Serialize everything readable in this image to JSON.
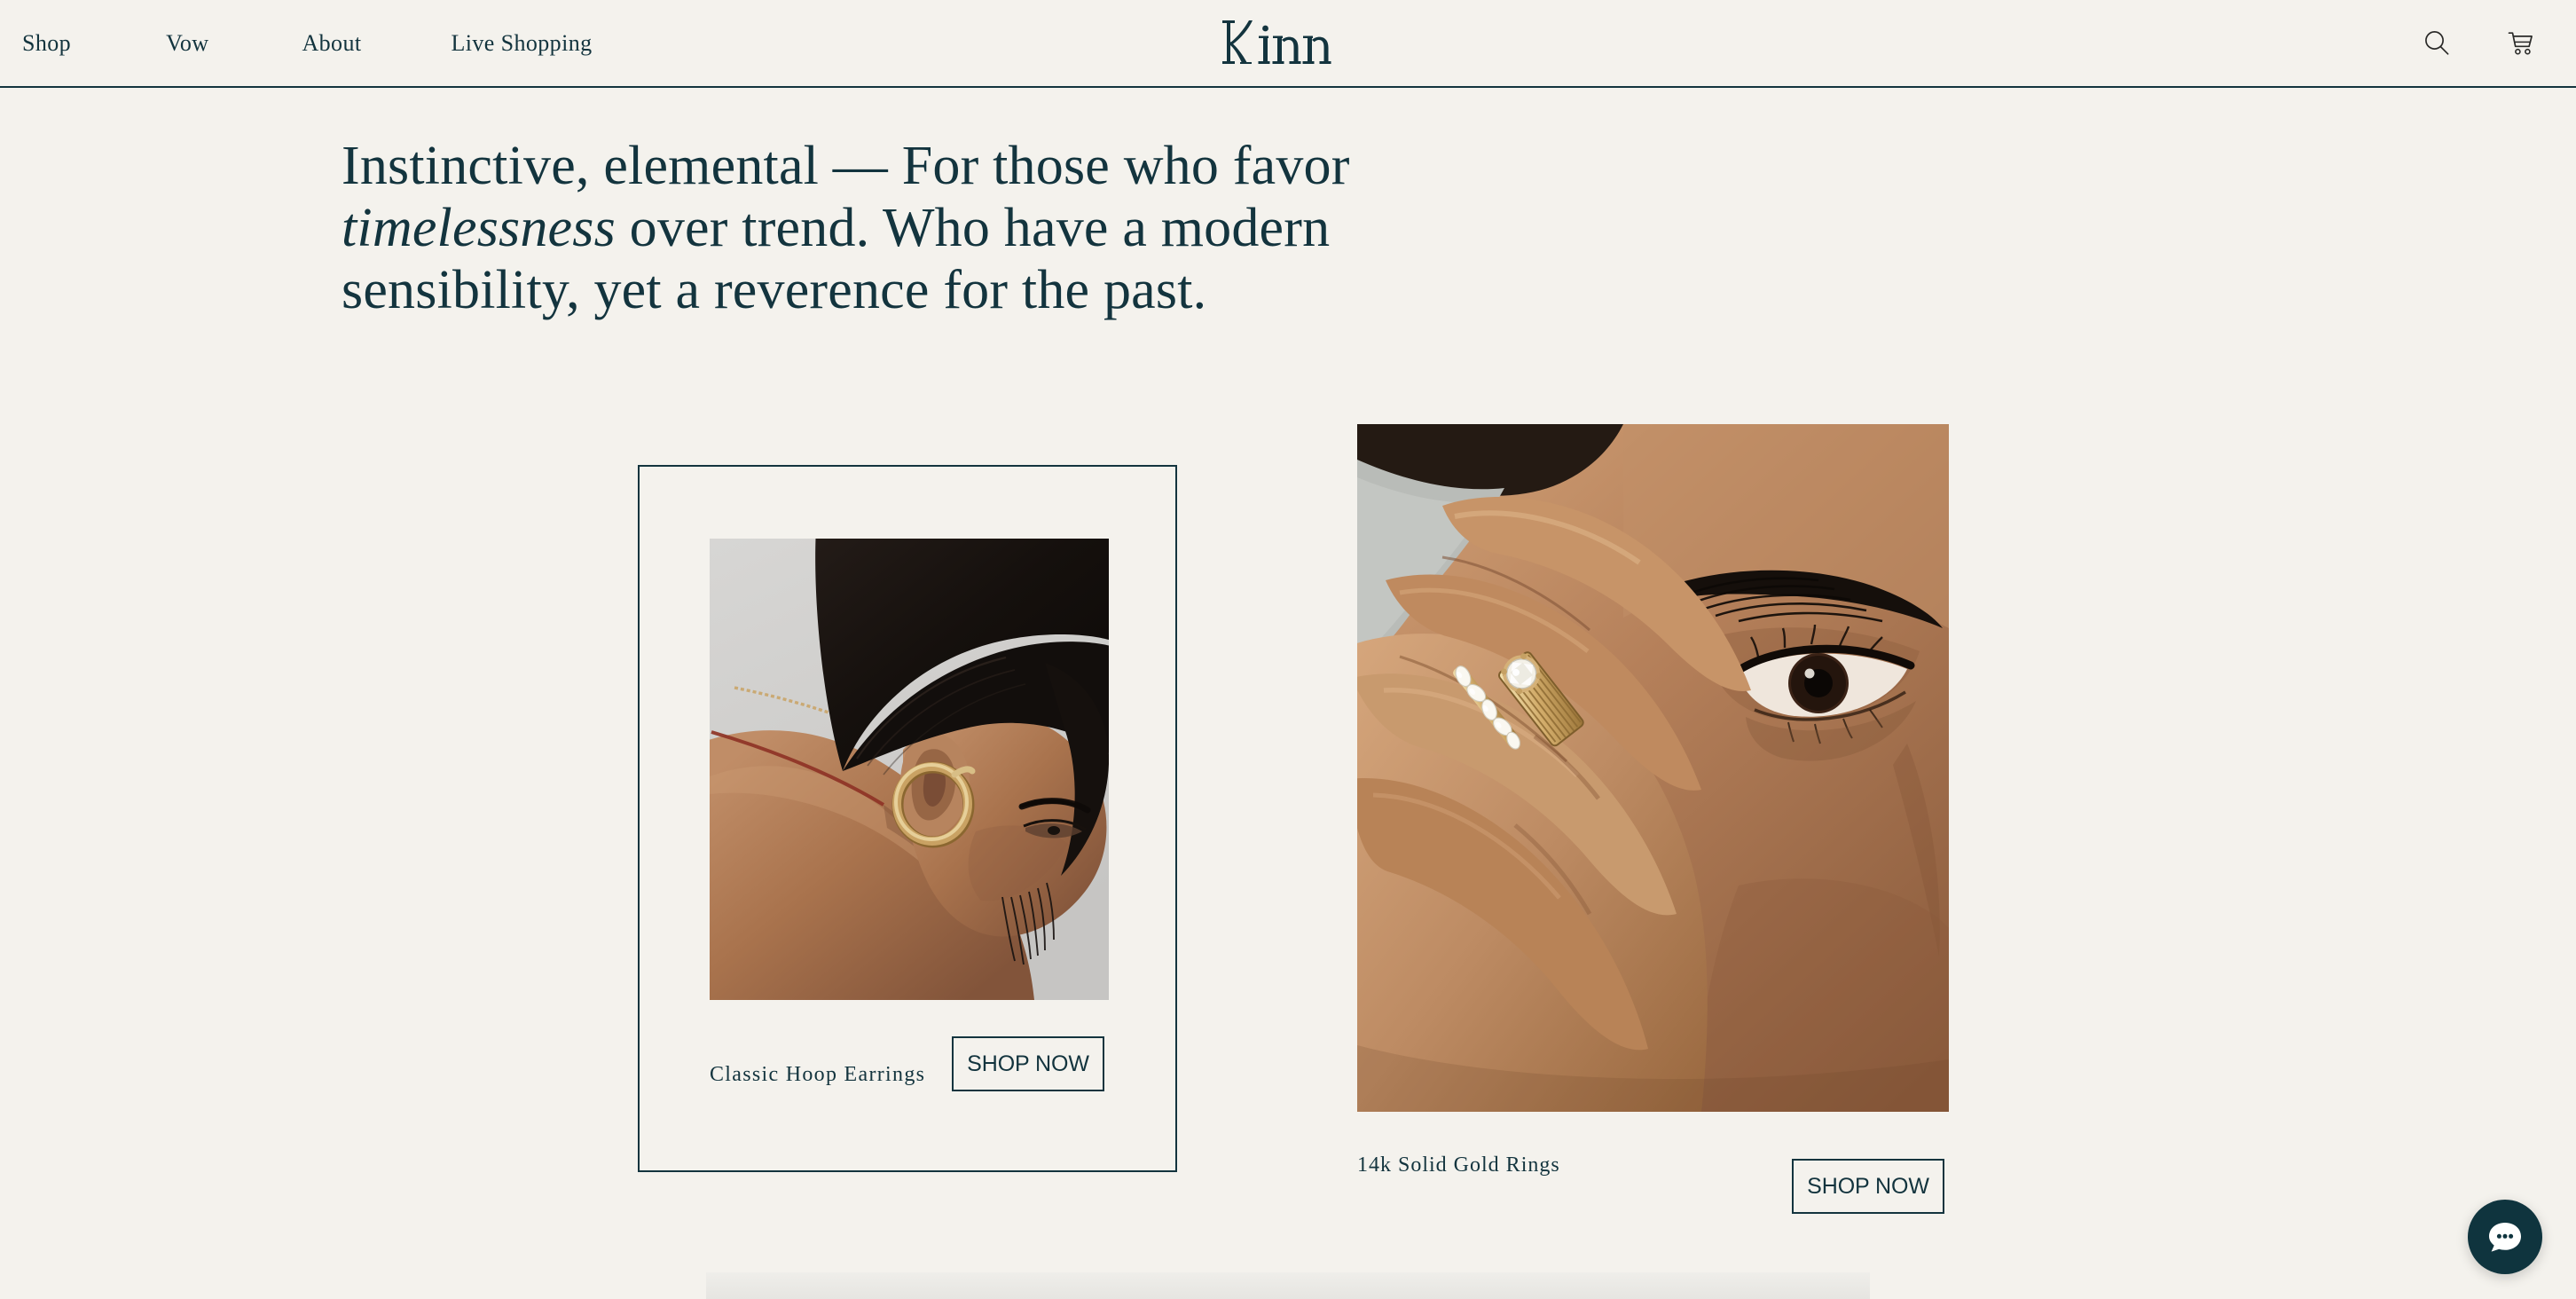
{
  "theme": {
    "background": "#F4F2ED",
    "ink": "#13343E",
    "accent": "#0F343E",
    "rule": "#13343E"
  },
  "header": {
    "brand": "Kinn",
    "nav": [
      {
        "label": "Shop"
      },
      {
        "label": "Vow"
      },
      {
        "label": "About"
      },
      {
        "label": "Live Shopping"
      }
    ],
    "actions": [
      {
        "icon": "search-icon",
        "label": "Search"
      },
      {
        "icon": "cart-icon",
        "label": "Cart"
      }
    ]
  },
  "hero": {
    "line1_a": "Instinctive, elemental ",
    "line1_dash": "— ",
    "line1_b": "For those who favor",
    "line2_em": "timelessness",
    "line2_rest": " over trend. Who have a modern",
    "line3": "sensibility, yet a reverence for the past."
  },
  "products": [
    {
      "id": "classic-hoop-earrings",
      "title": "Classic Hoop Earrings",
      "cta": "SHOP NOW",
      "image_alt": "Woman leaning over, gold hoop earring on ear, pale gray studio backdrop"
    },
    {
      "id": "14k-solid-gold-rings",
      "title": "14k Solid Gold Rings",
      "cta": "SHOP NOW",
      "image_alt": "Close up of a face with hand raised, stacked diamond and ridged gold rings on finger"
    }
  ],
  "chat": {
    "label": "Open chat",
    "icon": "chat-bubble-icon"
  }
}
